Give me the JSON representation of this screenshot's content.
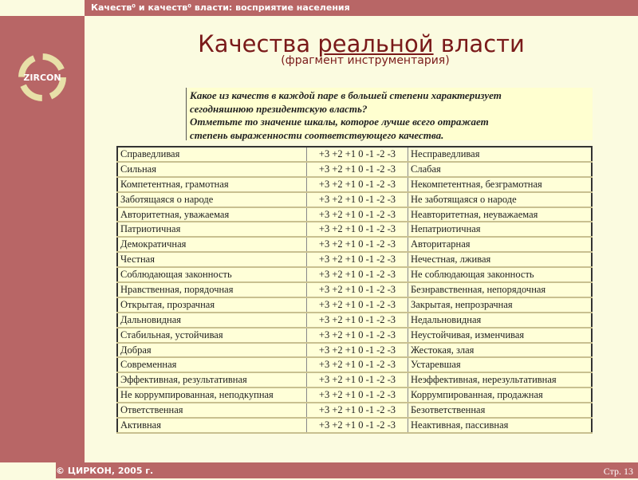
{
  "header": {
    "title": "Качеств⁰ и качеств⁰ власти: восприятие населения"
  },
  "logo": {
    "text": "ZIRCON"
  },
  "main": {
    "title_pre": "Качества ",
    "title_u": "реальной",
    "title_post": " власти",
    "subtitle": "(фрагмент инструментария)",
    "question": [
      "Какое из качеств в каждой паре в большей степени характеризует",
      "сегодняшнюю президентскую власть?",
      "Отметьте то значение шкалы, которое лучше всего отражает",
      "степень выраженности соответствующего качества."
    ]
  },
  "scale": "+3 +2 +1 0 -1 -2 -3",
  "rows": [
    [
      "Справедливая",
      "Несправедливая"
    ],
    [
      "Сильная",
      "Слабая"
    ],
    [
      "Компетентная, грамотная",
      "Некомпетентная, безграмотная"
    ],
    [
      "Заботящаяся о народе",
      "Не заботящаяся о народе"
    ],
    [
      "Авторитетная, уважаемая",
      "Неавторитетная, неуважаемая"
    ],
    [
      "Патриотичная",
      "Непатриотичная"
    ],
    [
      "Демократичная",
      "Авторитарная"
    ],
    [
      "Честная",
      "Нечестная, лживая"
    ],
    [
      "Соблюдающая законность",
      "Не соблюдающая законность"
    ],
    [
      "Нравственная, порядочная",
      "Безнравственная, непорядочная"
    ],
    [
      "Открытая, прозрачная",
      "Закрытая, непрозрачная"
    ],
    [
      "Дальновидная",
      "Недальновидная"
    ],
    [
      "Стабильная, устойчивая",
      "Неустойчивая, изменчивая"
    ],
    [
      "Добрая",
      "Жестокая, злая"
    ],
    [
      "Современная",
      "Устаревшая"
    ],
    [
      "Эффективная, результативная",
      "Неэффективная, нерезультативная"
    ],
    [
      "Не коррумпированная, неподкупная",
      "Коррумпированная, продажная"
    ],
    [
      "Ответственная",
      "Безответственная"
    ],
    [
      "Активная",
      "Неактивная, пассивная"
    ]
  ],
  "footer": {
    "copyright": "© ЦИРКОН, 2005 г.",
    "page": "Стр. 13"
  }
}
